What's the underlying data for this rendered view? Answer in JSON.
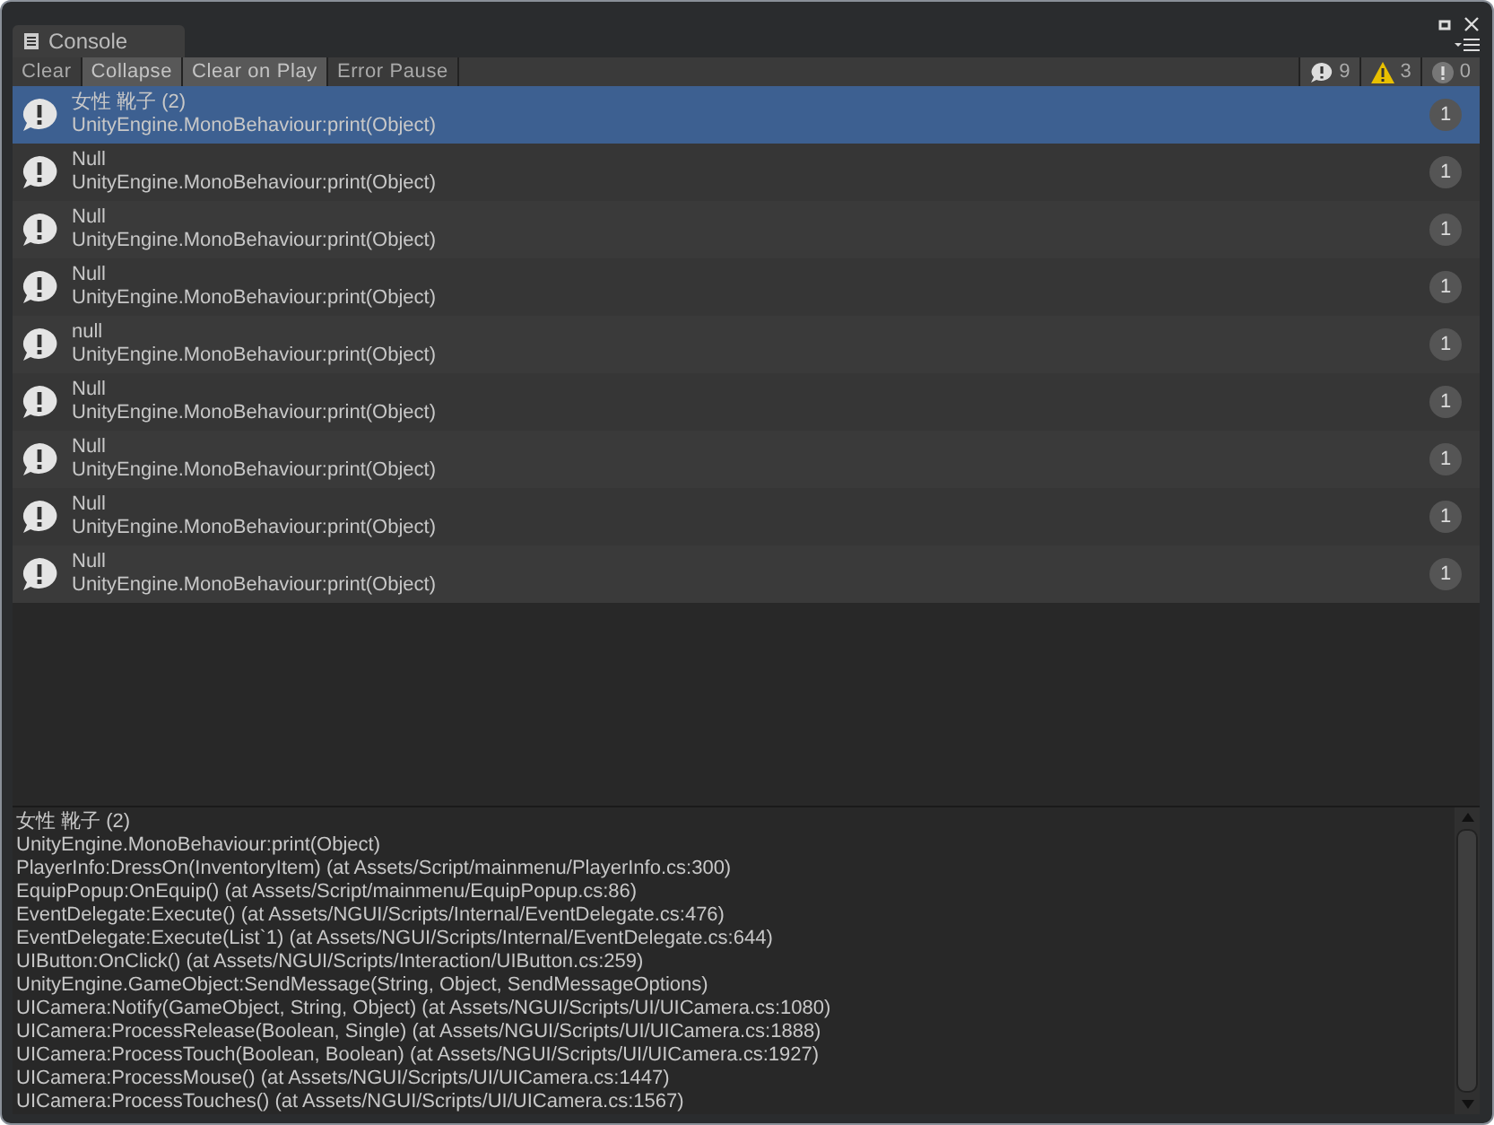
{
  "window": {
    "title": "Console"
  },
  "toolbar": {
    "buttons": [
      {
        "label": "Clear",
        "kind": "button"
      },
      {
        "label": "Collapse",
        "kind": "toggle",
        "on": true
      },
      {
        "label": "Clear on Play",
        "kind": "toggle",
        "on": true
      },
      {
        "label": "Error Pause",
        "kind": "toggle",
        "on": false
      }
    ],
    "counters": [
      {
        "kind": "log",
        "count": "9"
      },
      {
        "kind": "warning",
        "count": "3"
      },
      {
        "kind": "error",
        "count": "0"
      }
    ]
  },
  "entries": [
    {
      "message": "女性 靴子 (2)",
      "source": "UnityEngine.MonoBehaviour:print(Object)",
      "count": "1",
      "selected": true
    },
    {
      "message": "Null",
      "source": "UnityEngine.MonoBehaviour:print(Object)",
      "count": "1",
      "selected": false
    },
    {
      "message": "Null",
      "source": "UnityEngine.MonoBehaviour:print(Object)",
      "count": "1",
      "selected": false
    },
    {
      "message": "Null",
      "source": "UnityEngine.MonoBehaviour:print(Object)",
      "count": "1",
      "selected": false
    },
    {
      "message": "null",
      "source": "UnityEngine.MonoBehaviour:print(Object)",
      "count": "1",
      "selected": false
    },
    {
      "message": "Null",
      "source": "UnityEngine.MonoBehaviour:print(Object)",
      "count": "1",
      "selected": false
    },
    {
      "message": "Null",
      "source": "UnityEngine.MonoBehaviour:print(Object)",
      "count": "1",
      "selected": false
    },
    {
      "message": "Null",
      "source": "UnityEngine.MonoBehaviour:print(Object)",
      "count": "1",
      "selected": false
    },
    {
      "message": "Null",
      "source": "UnityEngine.MonoBehaviour:print(Object)",
      "count": "1",
      "selected": false
    }
  ],
  "detail": [
    "女性 靴子 (2)",
    "UnityEngine.MonoBehaviour:print(Object)",
    "PlayerInfo:DressOn(InventoryItem) (at Assets/Script/mainmenu/PlayerInfo.cs:300)",
    "EquipPopup:OnEquip() (at Assets/Script/mainmenu/EquipPopup.cs:86)",
    "EventDelegate:Execute() (at Assets/NGUI/Scripts/Internal/EventDelegate.cs:476)",
    "EventDelegate:Execute(List`1) (at Assets/NGUI/Scripts/Internal/EventDelegate.cs:644)",
    "UIButton:OnClick() (at Assets/NGUI/Scripts/Interaction/UIButton.cs:259)",
    "UnityEngine.GameObject:SendMessage(String, Object, SendMessageOptions)",
    "UICamera:Notify(GameObject, String, Object) (at Assets/NGUI/Scripts/UI/UICamera.cs:1080)",
    "UICamera:ProcessRelease(Boolean, Single) (at Assets/NGUI/Scripts/UI/UICamera.cs:1888)",
    "UICamera:ProcessTouch(Boolean, Boolean) (at Assets/NGUI/Scripts/UI/UICamera.cs:1927)",
    "UICamera:ProcessMouse() (at Assets/NGUI/Scripts/UI/UICamera.cs:1447)",
    "UICamera:ProcessTouches() (at Assets/NGUI/Scripts/UI/UICamera.cs:1567)"
  ]
}
